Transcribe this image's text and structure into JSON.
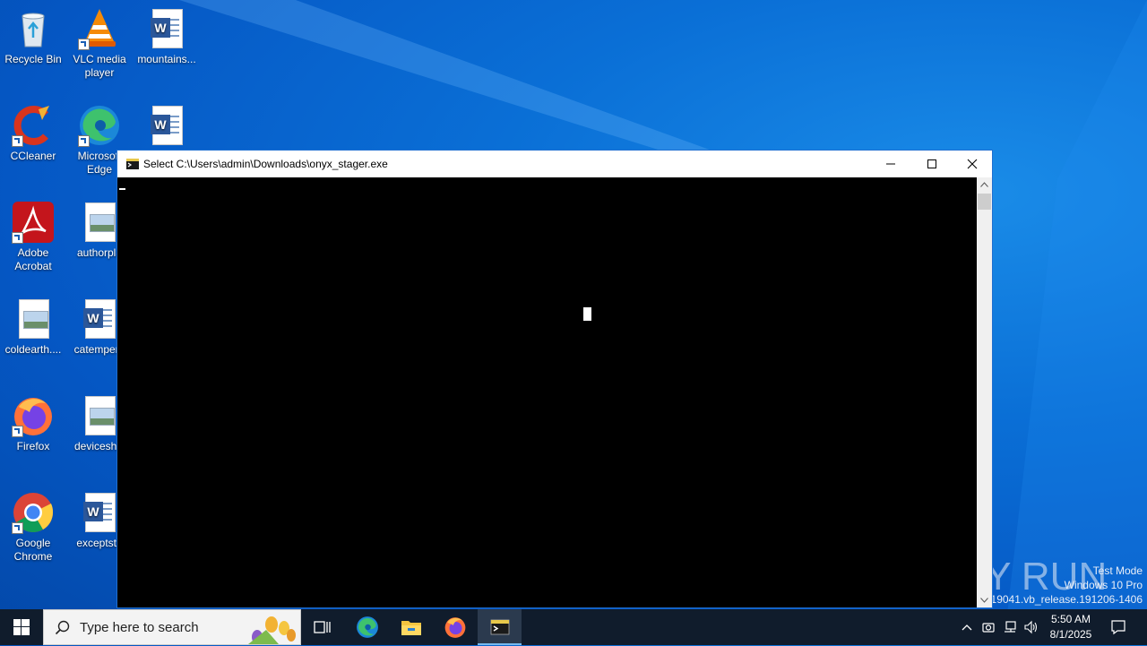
{
  "desktop": {
    "icons": [
      {
        "label": "Recycle Bin",
        "icon": "recycle-bin-icon"
      },
      {
        "label": "VLC media player",
        "icon": "vlc-icon"
      },
      {
        "label": "mountains...",
        "icon": "word-document-icon"
      },
      {
        "label": "CCleaner",
        "icon": "ccleaner-icon"
      },
      {
        "label": "Microsoft Edge",
        "icon": "edge-icon"
      },
      {
        "label": "",
        "icon": "word-document-icon"
      },
      {
        "label": "Adobe Acrobat",
        "icon": "acrobat-icon"
      },
      {
        "label": "authorpla",
        "icon": "image-document-icon"
      },
      {
        "label": "coldearth....",
        "icon": "image-document-icon"
      },
      {
        "label": "catempera",
        "icon": "word-document-icon"
      },
      {
        "label": "Firefox",
        "icon": "firefox-icon"
      },
      {
        "label": "deviceshis",
        "icon": "image-document-icon"
      },
      {
        "label": "Google Chrome",
        "icon": "chrome-icon"
      },
      {
        "label": "exceptsto",
        "icon": "word-document-icon"
      }
    ]
  },
  "window": {
    "title": "Select C:\\Users\\admin\\Downloads\\onyx_stager.exe",
    "minimize_icon": "minimize-icon",
    "maximize_icon": "maximize-icon",
    "close_icon": "close-icon"
  },
  "watermark": {
    "logo": "ANY RUN",
    "line1": "Test Mode",
    "line2": "Windows 10 Pro",
    "line3": "Build 19041.vb_release.191206-1406"
  },
  "taskbar": {
    "search_placeholder": "Type here to search",
    "time": "5:50 AM",
    "date": "8/1/2025"
  },
  "colors": {
    "accent": "#0078d7",
    "taskbar": "#101c2c",
    "console_bg": "#000000"
  }
}
